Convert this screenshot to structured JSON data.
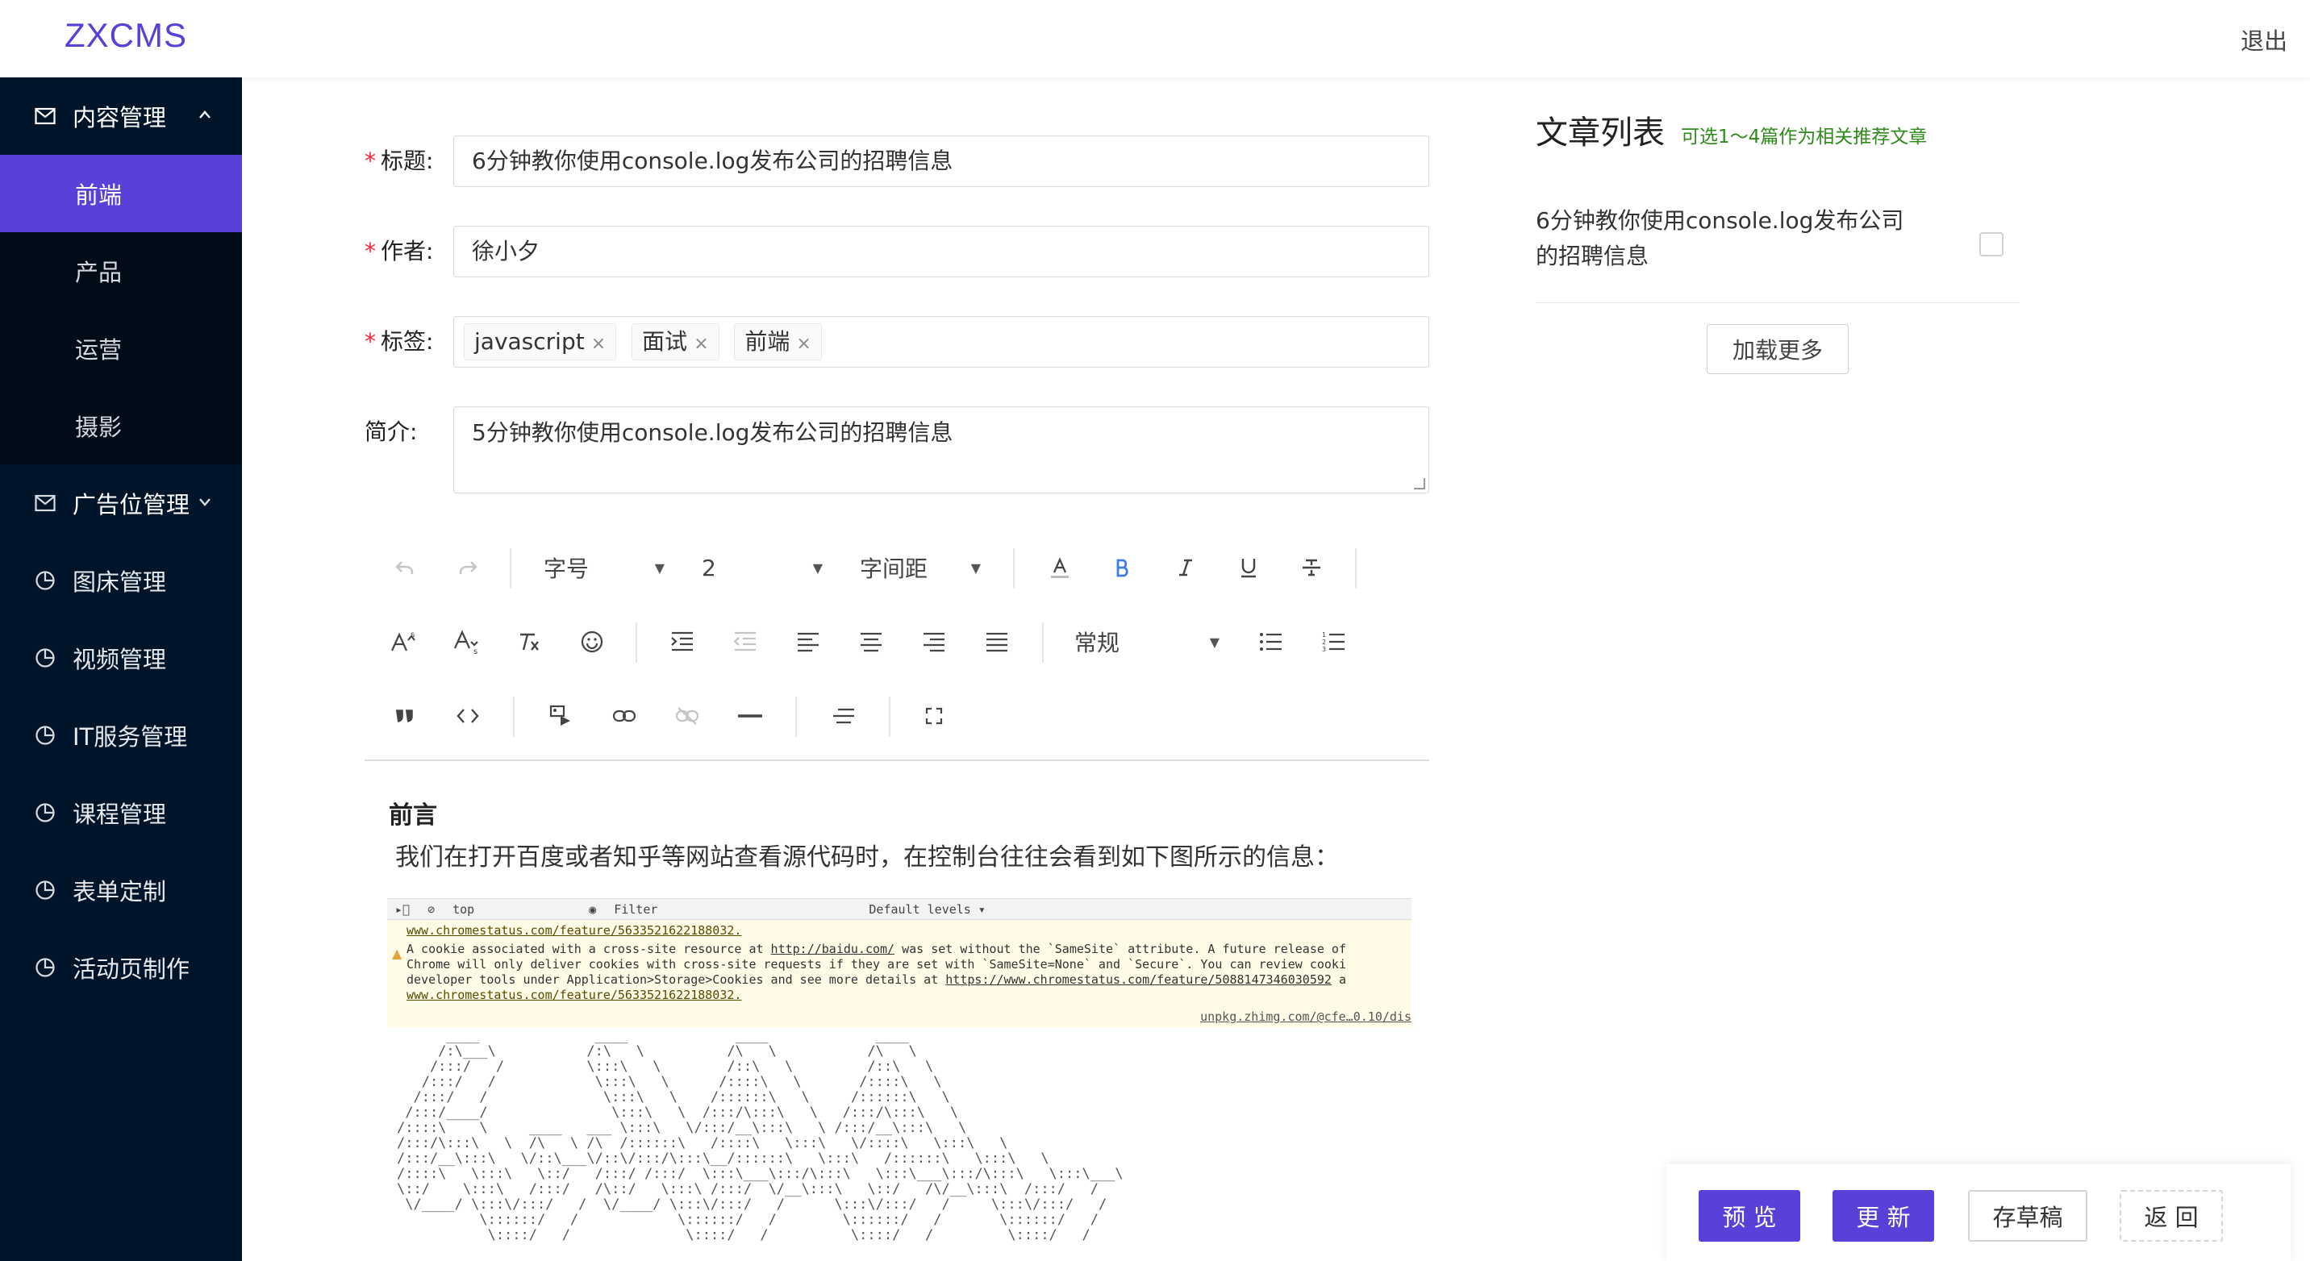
{
  "app": {
    "logo": "ZXCMS",
    "logout": "退出"
  },
  "sidebar": {
    "content_group": {
      "label": "内容管理",
      "icon": "mail-icon",
      "expanded": true
    },
    "content_items": [
      {
        "label": "前端",
        "active": true
      },
      {
        "label": "产品"
      },
      {
        "label": "运营"
      },
      {
        "label": "摄影"
      }
    ],
    "ad_group": {
      "label": "广告位管理",
      "icon": "mail-icon"
    },
    "items": [
      {
        "label": "图床管理",
        "icon": "pie-chart-icon"
      },
      {
        "label": "视频管理",
        "icon": "pie-chart-icon"
      },
      {
        "label": "IT服务管理",
        "icon": "pie-chart-icon"
      },
      {
        "label": "课程管理",
        "icon": "pie-chart-icon"
      },
      {
        "label": "表单定制",
        "icon": "pie-chart-icon"
      },
      {
        "label": "活动页制作",
        "icon": "pie-chart-icon"
      }
    ]
  },
  "form": {
    "required_mark": "*",
    "title": {
      "label": "标题:",
      "value": "6分钟教你使用console.log发布公司的招聘信息"
    },
    "author": {
      "label": "作者:",
      "value": "徐小夕"
    },
    "tags": {
      "label": "标签:",
      "values": [
        "javascript",
        "面试",
        "前端"
      ],
      "remove": "×"
    },
    "summary": {
      "label": "简介:",
      "value": "5分钟教你使用console.log发布公司的招聘信息"
    }
  },
  "toolbar": {
    "font_size_label": "字号",
    "line_height_value": "2",
    "letter_spacing_label": "字间距",
    "heading_label": "常规",
    "undo_icon": "undo-icon",
    "redo_icon": "redo-icon"
  },
  "editor": {
    "heading": "前言",
    "paragraph": "我们在打开百度或者知乎等网站查看源代码时，在控制台往往会看到如下图所示的信息：",
    "console": {
      "context": "top",
      "filter": "Filter",
      "levels": "Default levels ▾",
      "line1": "www.chromestatus.com/feature/5633521622188032.",
      "line2_prefix": "A cookie associated with a cross-site resource at ",
      "line2_link": "http://baidu.com/",
      "line2_suffix": " was set without the `SameSite` attribute. A future release of",
      "line3": "Chrome will only deliver cookies with cross-site requests if they are set with `SameSite=None` and `Secure`. You can review cooki",
      "line4_prefix": "developer tools under Application>Storage>Cookies and see more details at ",
      "line4_link": "https://www.chromestatus.com/feature/5088147346030592",
      "line4_suffix": " a",
      "line5": "www.chromestatus.com/feature/5633521622188032.",
      "source": "unpkg.zhimg.com/@cfe…0.10/dis"
    },
    "ascii_art": "      ____              ____             ____             ____\n     /:\\___\\           /:\\   \\          /\\   \\           /\\   \\\n    /:::/   /          \\:::\\   \\        /::\\   \\         /::\\   \\\n   /:::/   /            \\:::\\   \\      /::::\\   \\       /::::\\   \\\n  /:::/   /              \\:::\\   \\    /::::::\\   \\     /::::::\\   \\\n /:::/____/               \\:::\\   \\  /:::/\\:::\\   \\   /:::/\\:::\\   \\\n/::::\\    \\     ____   ___ \\:::\\   \\/:::/__\\:::\\   \\ /:::/__\\:::\\   \\\n/:::/\\:::\\   \\  /\\   \\ /\\  /::::::\\   /::::\\   \\:::\\   \\/::::\\   \\:::\\   \\\n/:::/__\\:::\\   \\/::\\___\\/::\\/:::/\\:::\\__/::::::\\   \\:::\\   /::::::\\   \\:::\\   \\\n/::::\\   \\:::\\   \\::/   /:::/ /:::/  \\:::\\___\\:::/\\:::\\   \\:::\\___\\:::/\\:::\\   \\:::\\___\\\n\\::/    \\:::\\   /:::/   /\\::/   \\:::\\ /:::/  \\/__\\:::\\   \\::/   /\\/__\\:::\\  /:::/   /\n \\/____/ \\:::\\/:::/   /  \\/____/ \\:::\\/:::/   /      \\:::\\/:::/   /     \\:::\\/:::/   /\n          \\::::::/   /            \\::::::/   /        \\::::::/   /       \\::::::/   /\n           \\::::/   /              \\::::/   /          \\::::/   /         \\::::/   /"
  },
  "article_list": {
    "title": "文章列表",
    "hint": "可选1～4篇作为相关推荐文章",
    "items": [
      {
        "title": "6分钟教你使用console.log发布公司的招聘信息",
        "line1": "6分钟教你使用console.log发布公司",
        "line2": "的招聘信息",
        "checked": false
      }
    ],
    "load_more": "加载更多"
  },
  "actions": {
    "preview": "预 览",
    "update": "更 新",
    "save_draft": "存草稿",
    "back": "返 回"
  },
  "colors": {
    "brand": "#5940d8",
    "sidebar_bg": "#001529",
    "submenu_bg": "#000c17",
    "required": "#f5222d",
    "hint": "#2f8a1a"
  }
}
